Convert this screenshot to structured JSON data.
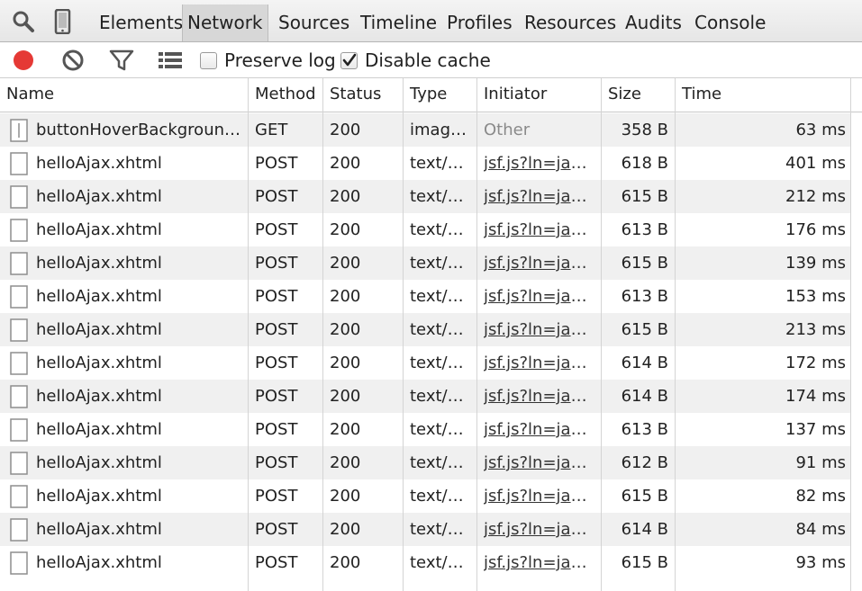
{
  "tabs": [
    {
      "label": "Elements",
      "selected": false
    },
    {
      "label": "Network",
      "selected": true
    },
    {
      "label": "Sources",
      "selected": false
    },
    {
      "label": "Timeline",
      "selected": false
    },
    {
      "label": "Profiles",
      "selected": false
    },
    {
      "label": "Resources",
      "selected": false
    },
    {
      "label": "Audits",
      "selected": false
    },
    {
      "label": "Console",
      "selected": false
    }
  ],
  "tools": {
    "inspect_icon": "magnifier-icon",
    "device_icon": "mobile-device-icon"
  },
  "toolbar": {
    "record_icon": "record-icon",
    "record_color": "#e53935",
    "clear_icon": "clear-icon",
    "filter_icon": "filter-icon",
    "view_icon": "list-view-icon",
    "preserve_log": {
      "label": "Preserve log",
      "checked": false
    },
    "disable_cache": {
      "label": "Disable cache",
      "checked": true
    }
  },
  "columns": {
    "name": "Name",
    "method": "Method",
    "status": "Status",
    "type": "Type",
    "initiator": "Initiator",
    "size": "Size",
    "time": "Time"
  },
  "requests": [
    {
      "name": "buttonHoverBackground.gif",
      "method": "GET",
      "status": "200",
      "type": "image/gif",
      "initiator": "Other",
      "initiator_link": false,
      "size": "358 B",
      "time": "63 ms"
    },
    {
      "name": "helloAjax.xhtml",
      "method": "POST",
      "status": "200",
      "type": "text/xml",
      "initiator": "jsf.js?ln=javax.faces",
      "initiator_link": true,
      "size": "618 B",
      "time": "401 ms"
    },
    {
      "name": "helloAjax.xhtml",
      "method": "POST",
      "status": "200",
      "type": "text/xml",
      "initiator": "jsf.js?ln=javax.faces",
      "initiator_link": true,
      "size": "615 B",
      "time": "212 ms"
    },
    {
      "name": "helloAjax.xhtml",
      "method": "POST",
      "status": "200",
      "type": "text/xml",
      "initiator": "jsf.js?ln=javax.faces",
      "initiator_link": true,
      "size": "613 B",
      "time": "176 ms"
    },
    {
      "name": "helloAjax.xhtml",
      "method": "POST",
      "status": "200",
      "type": "text/xml",
      "initiator": "jsf.js?ln=javax.faces",
      "initiator_link": true,
      "size": "615 B",
      "time": "139 ms"
    },
    {
      "name": "helloAjax.xhtml",
      "method": "POST",
      "status": "200",
      "type": "text/xml",
      "initiator": "jsf.js?ln=javax.faces",
      "initiator_link": true,
      "size": "613 B",
      "time": "153 ms"
    },
    {
      "name": "helloAjax.xhtml",
      "method": "POST",
      "status": "200",
      "type": "text/xml",
      "initiator": "jsf.js?ln=javax.faces",
      "initiator_link": true,
      "size": "615 B",
      "time": "213 ms"
    },
    {
      "name": "helloAjax.xhtml",
      "method": "POST",
      "status": "200",
      "type": "text/xml",
      "initiator": "jsf.js?ln=javax.faces",
      "initiator_link": true,
      "size": "614 B",
      "time": "172 ms"
    },
    {
      "name": "helloAjax.xhtml",
      "method": "POST",
      "status": "200",
      "type": "text/xml",
      "initiator": "jsf.js?ln=javax.faces",
      "initiator_link": true,
      "size": "614 B",
      "time": "174 ms"
    },
    {
      "name": "helloAjax.xhtml",
      "method": "POST",
      "status": "200",
      "type": "text/xml",
      "initiator": "jsf.js?ln=javax.faces",
      "initiator_link": true,
      "size": "613 B",
      "time": "137 ms"
    },
    {
      "name": "helloAjax.xhtml",
      "method": "POST",
      "status": "200",
      "type": "text/xml",
      "initiator": "jsf.js?ln=javax.faces",
      "initiator_link": true,
      "size": "612 B",
      "time": "91 ms"
    },
    {
      "name": "helloAjax.xhtml",
      "method": "POST",
      "status": "200",
      "type": "text/xml",
      "initiator": "jsf.js?ln=javax.faces",
      "initiator_link": true,
      "size": "615 B",
      "time": "82 ms"
    },
    {
      "name": "helloAjax.xhtml",
      "method": "POST",
      "status": "200",
      "type": "text/xml",
      "initiator": "jsf.js?ln=javax.faces",
      "initiator_link": true,
      "size": "614 B",
      "time": "84 ms"
    },
    {
      "name": "helloAjax.xhtml",
      "method": "POST",
      "status": "200",
      "type": "text/xml",
      "initiator": "jsf.js?ln=javax.faces",
      "initiator_link": true,
      "size": "615 B",
      "time": "93 ms"
    }
  ]
}
